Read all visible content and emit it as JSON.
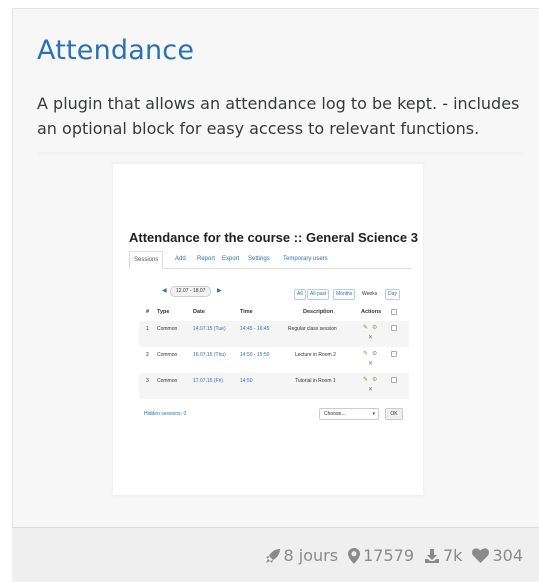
{
  "card": {
    "title": "Attendance",
    "description": "A plugin that allows an attendance log to be kept. - includes an optional block for easy access to relevant functions."
  },
  "preview": {
    "title": "Attendance for the course :: General Science 3",
    "tabs": [
      "Sessions",
      "Add",
      "Report",
      "Export",
      "Settings",
      "Temporary users"
    ],
    "date_range": "12.07 - 18.07",
    "view_buttons": [
      "All",
      "All past",
      "Months",
      "Weeks",
      "Day"
    ],
    "columns": [
      "#",
      "Type",
      "Date",
      "Time",
      "Description",
      "Actions"
    ],
    "rows": [
      {
        "num": "1",
        "type": "Common",
        "date": "14.07.15 (Tue)",
        "time": "14:45 - 16:45",
        "description": "Regular class session"
      },
      {
        "num": "2",
        "type": "Common",
        "date": "16.07.15 (Thu)",
        "time": "14:50 - 15:50",
        "description": "Lecture in Room 2"
      },
      {
        "num": "3",
        "type": "Common",
        "date": "17.07.15 (Fri)",
        "time": "14:50",
        "description": "Tutorial in Room 1"
      }
    ],
    "hidden_sessions": "Hidden sessions: 0",
    "choose_placeholder": "Choose...",
    "ok_label": "OK"
  },
  "stats": {
    "age": "8 jours",
    "sites": "17579",
    "downloads": "7k",
    "favourites": "304"
  },
  "colors": {
    "accent": "#2a72b5",
    "icon_gray": "#8a8a8a",
    "card_bg": "#f7f7f7"
  },
  "icons": {
    "age": "rocket-icon",
    "sites": "map-marker-icon",
    "downloads": "download-icon",
    "favourites": "heart-icon"
  }
}
